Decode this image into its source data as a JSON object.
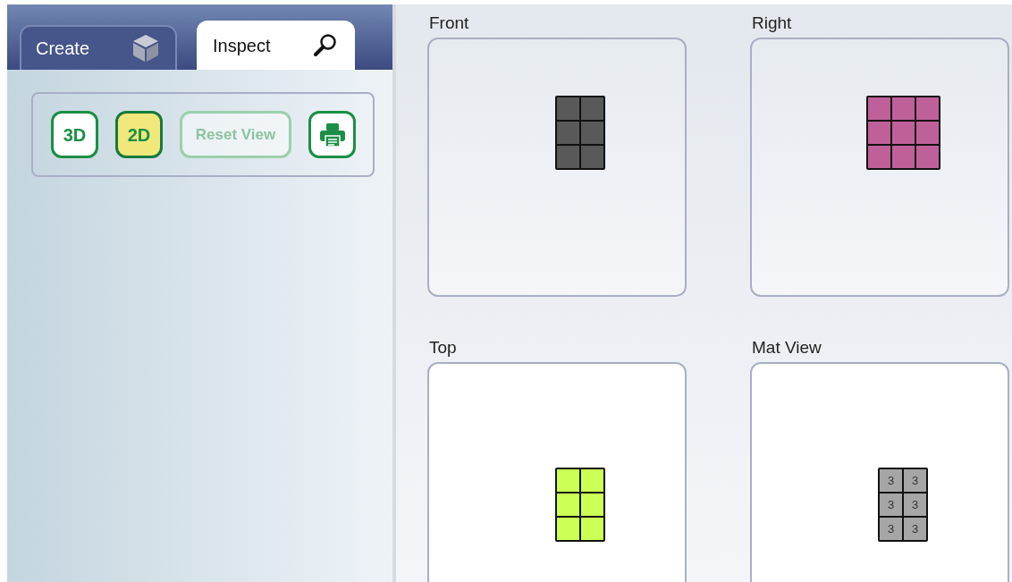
{
  "tabs": [
    {
      "label": "Create",
      "selected": false,
      "kind": "create"
    },
    {
      "label": "Inspect",
      "selected": true,
      "kind": "inspect"
    }
  ],
  "toolbar": [
    {
      "kind": "text",
      "label": "3D",
      "selected": false,
      "disabled": false
    },
    {
      "kind": "text",
      "label": "2D",
      "selected": true,
      "disabled": false
    },
    {
      "kind": "text",
      "label": "Reset View",
      "selected": false,
      "disabled": true
    },
    {
      "kind": "print",
      "selected": false,
      "disabled": false
    }
  ],
  "views": [
    {
      "title": "Front",
      "kind": "blocks",
      "color": "#595959",
      "cells": [
        [
          true,
          true
        ],
        [
          true,
          true
        ],
        [
          true,
          true
        ]
      ]
    },
    {
      "title": "Right",
      "kind": "blocks",
      "color": "#c0609a",
      "cells": [
        [
          true,
          true,
          true
        ],
        [
          true,
          true,
          true
        ],
        [
          true,
          true,
          true
        ]
      ]
    },
    {
      "title": "Top",
      "kind": "blocks",
      "color": "#ccff55",
      "cells": [
        [
          true,
          true
        ],
        [
          true,
          true
        ],
        [
          true,
          true
        ]
      ]
    },
    {
      "title": "Mat View",
      "kind": "mat",
      "color": "#a6a6a6",
      "cells": [
        [
          "3",
          "3"
        ],
        [
          "3",
          "3"
        ],
        [
          "3",
          "3"
        ]
      ]
    }
  ]
}
